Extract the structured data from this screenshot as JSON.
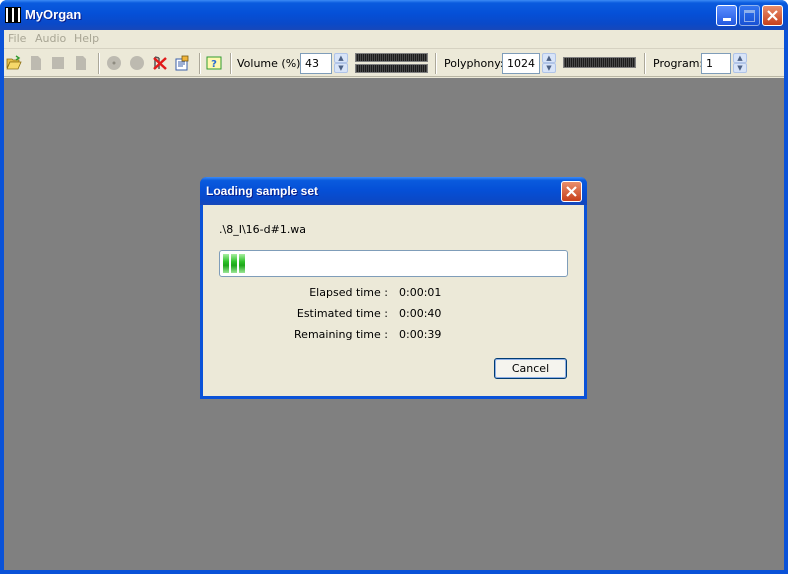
{
  "window": {
    "title": "MyOrgan"
  },
  "menu": [
    "File",
    "Audio",
    "Help"
  ],
  "toolbar": {
    "volume_label": "Volume (%):",
    "volume_value": "43",
    "polyphony_label": "Polyphony:",
    "polyphony_value": "1024",
    "program_label": "Program:",
    "program_value": "1",
    "icons": [
      "open-folder-icon",
      "document-icon",
      "save-icon",
      "document-icon",
      "record-icon",
      "record-icon",
      "panic-icon",
      "settings-icon",
      "help-icon"
    ]
  },
  "dialog": {
    "title": "Loading sample set",
    "file": ".\\8_I\\16-d#1.wa",
    "progress": 0.08,
    "rows": [
      {
        "label": "Elapsed time :",
        "value": "0:00:01"
      },
      {
        "label": "Estimated time :",
        "value": "0:00:40"
      },
      {
        "label": "Remaining time :",
        "value": "0:00:39"
      }
    ],
    "cancel_label": "Cancel"
  },
  "colors": {
    "titlebar": "#0550d7",
    "workspace": "#808080",
    "progress_green": "#2fc12a"
  }
}
